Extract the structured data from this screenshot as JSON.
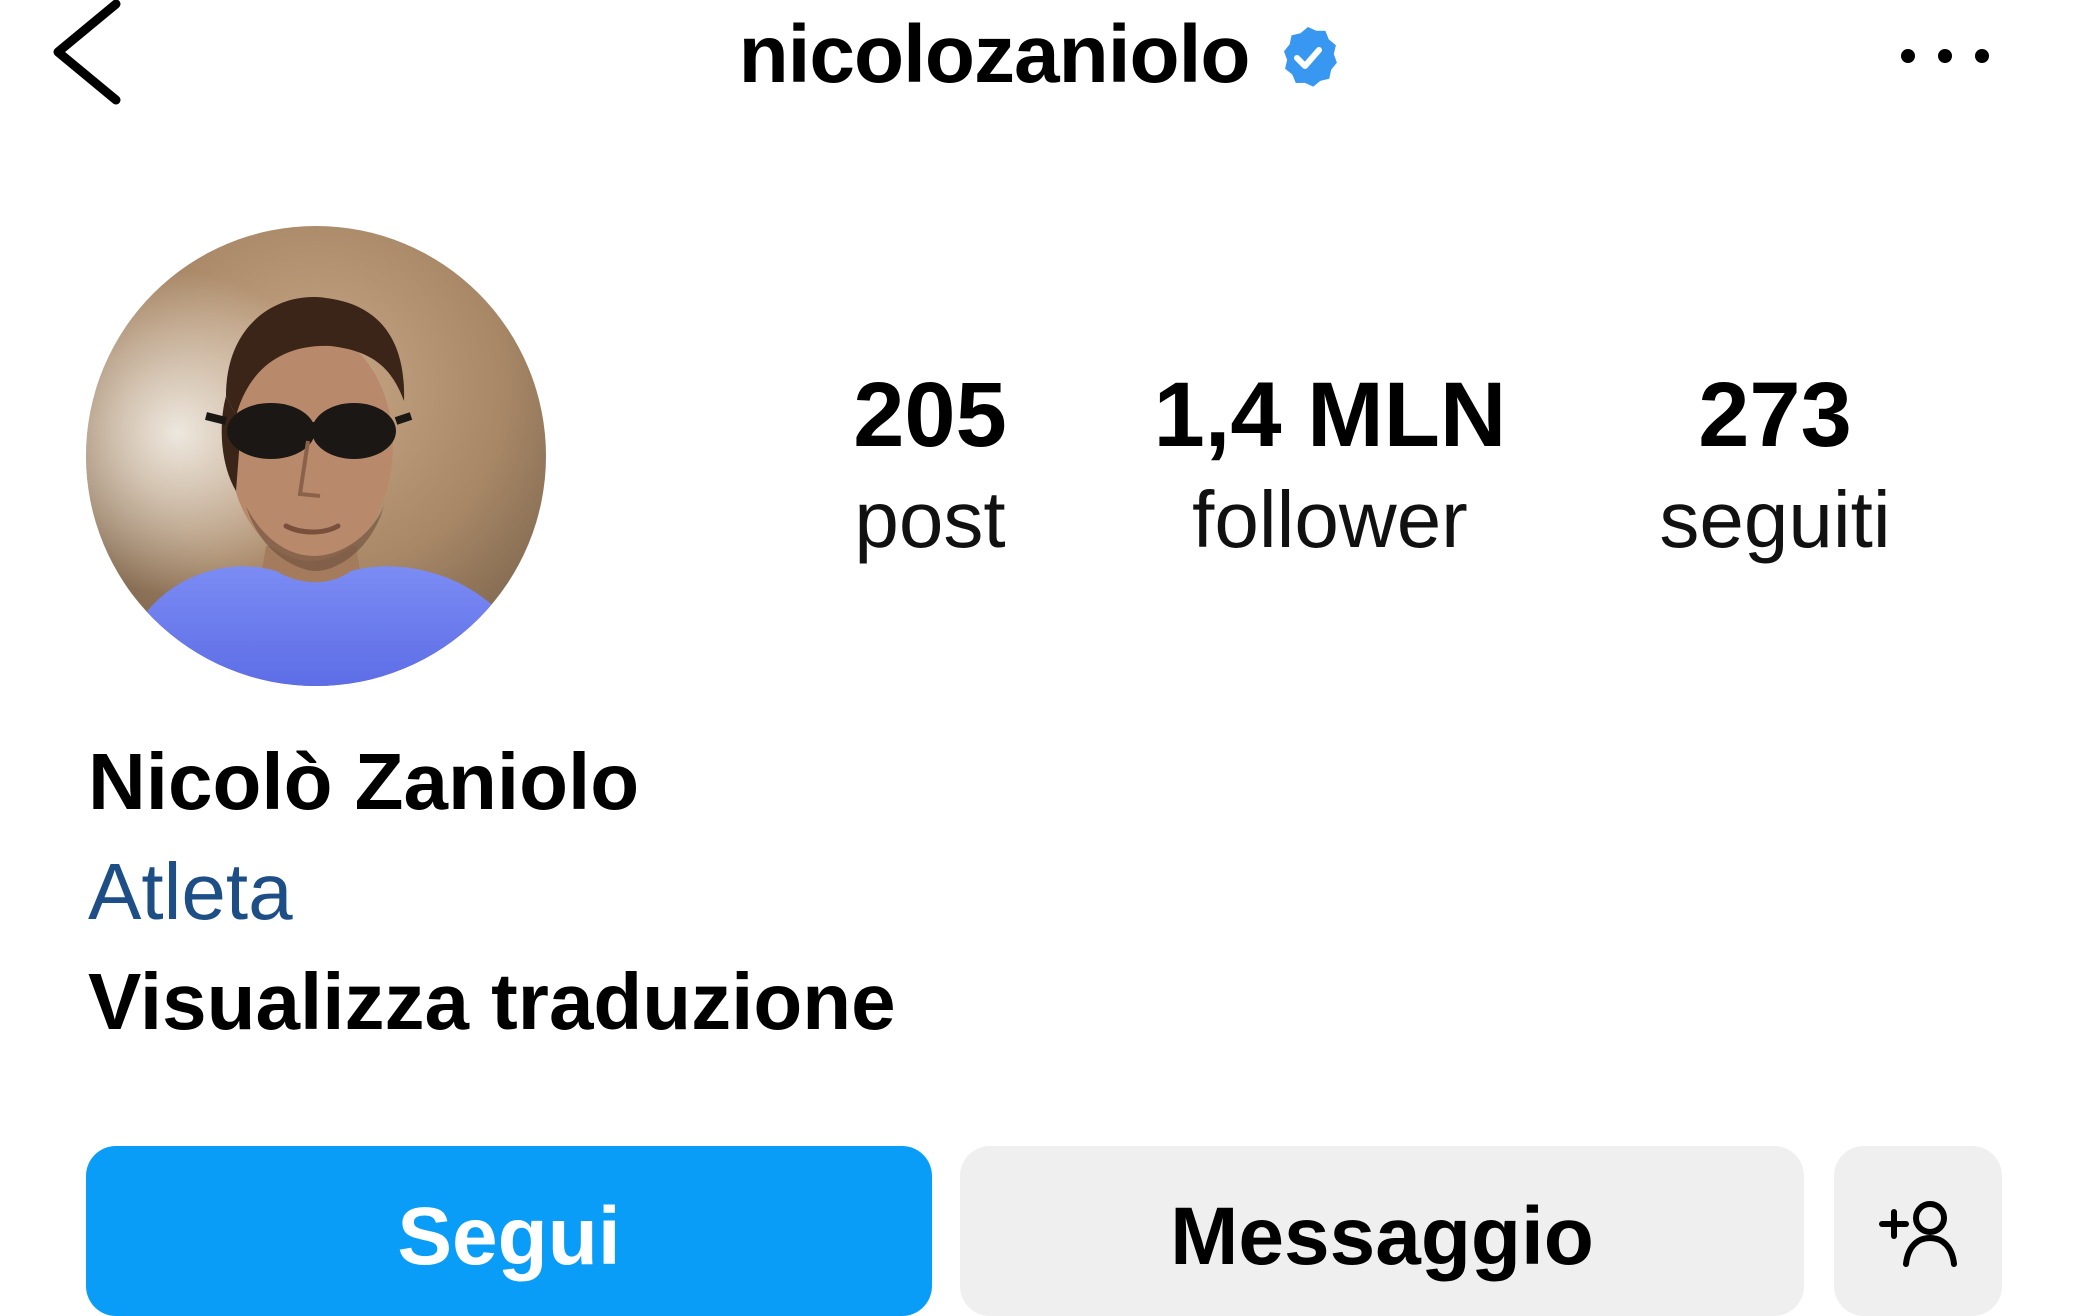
{
  "header": {
    "username": "nicolozaniolo",
    "back_icon": "chevron-left-icon",
    "verified_icon": "verified-badge-icon",
    "more_icon": "more-horizontal-icon"
  },
  "profile": {
    "avatar_icon": "profile-photo",
    "stats": {
      "posts": {
        "value": "205",
        "label": "post"
      },
      "followers": {
        "value": "1,4 MLN",
        "label": "follower"
      },
      "following": {
        "value": "273",
        "label": "seguiti"
      }
    },
    "full_name": "Nicolò Zaniolo",
    "category": "Atleta",
    "translate_label": "Visualizza traduzione"
  },
  "actions": {
    "follow_label": "Segui",
    "message_label": "Messaggio",
    "suggest_icon": "add-person-icon"
  },
  "colors": {
    "follow_button": "#0a9df7",
    "secondary_button": "#efefef",
    "category_text": "#1d4f86",
    "verified_badge": "#3897f0"
  }
}
